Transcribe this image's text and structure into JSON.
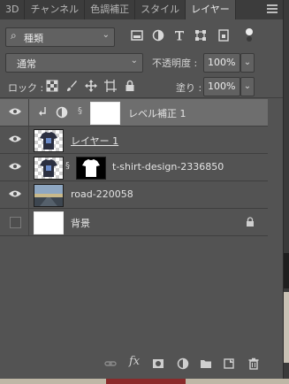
{
  "tabs": [
    "3D",
    "チャンネル",
    "色調補正",
    "スタイル",
    "レイヤー"
  ],
  "active_tab": 4,
  "filter": {
    "label": "種類"
  },
  "blend_mode": "通常",
  "opacity": {
    "label": "不透明度 :",
    "value": "100%"
  },
  "lock": {
    "label": "ロック :"
  },
  "fill": {
    "label": "塗り :",
    "value": "100%"
  },
  "layers": [
    {
      "name": "レベル補正 1",
      "visible": true,
      "selected": true,
      "type": "adjustment"
    },
    {
      "name": "レイヤー 1",
      "visible": true,
      "selected": false,
      "type": "pixel"
    },
    {
      "name": "t-shirt-design-2336850",
      "visible": true,
      "selected": false,
      "type": "masked"
    },
    {
      "name": "road-220058",
      "visible": true,
      "selected": false,
      "type": "image"
    },
    {
      "name": "背景",
      "visible": false,
      "selected": false,
      "type": "background",
      "locked": true
    }
  ],
  "icons": {
    "filter": [
      "image-filter-icon",
      "adjustment-filter-icon",
      "type-filter-icon",
      "shape-filter-icon",
      "smart-object-filter-icon"
    ],
    "lock": [
      "lock-transparent-icon",
      "lock-brush-icon",
      "lock-move-icon",
      "lock-artboard-icon",
      "lock-all-icon"
    ],
    "bottom": [
      "link-layers-icon",
      "fx-icon",
      "add-mask-icon",
      "new-adjustment-icon",
      "new-group-icon",
      "new-layer-icon",
      "delete-icon"
    ]
  },
  "bottom_fx_label": "fx"
}
